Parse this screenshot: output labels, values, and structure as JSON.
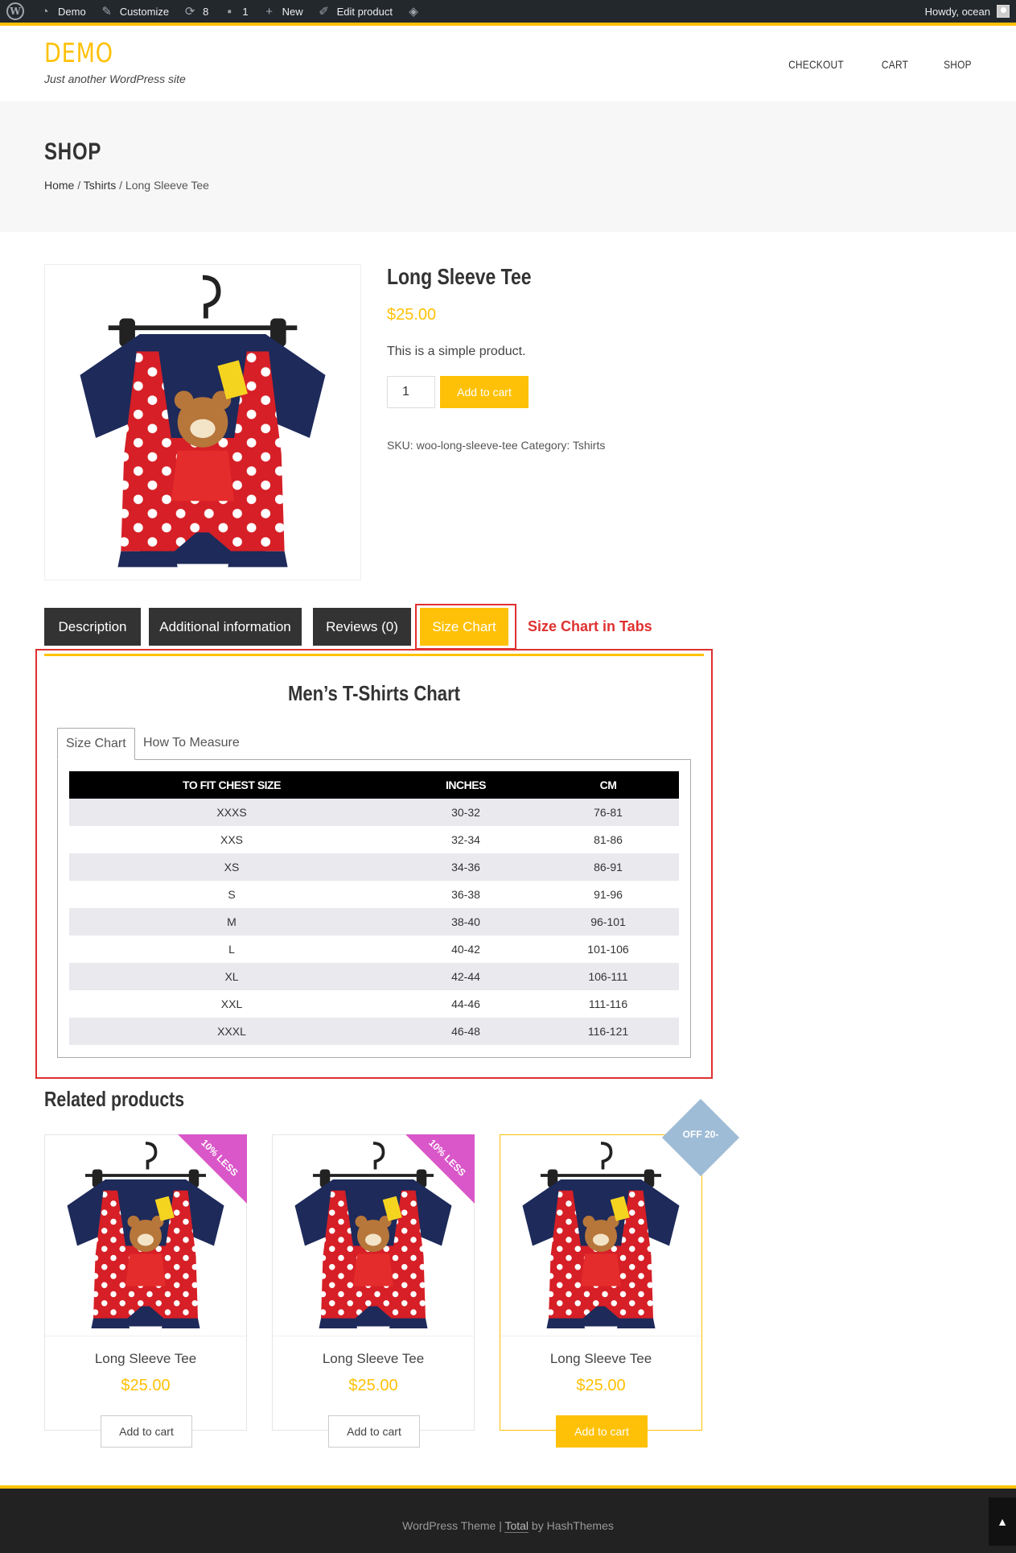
{
  "admin_bar": {
    "logo": "W",
    "items": [
      {
        "label": "Demo",
        "icon": "dashboard-icon"
      },
      {
        "label": "Customize",
        "icon": "brush-icon"
      },
      {
        "label": "8",
        "icon": "updates-icon"
      },
      {
        "label": "1",
        "icon": "comment-icon"
      },
      {
        "label": "New",
        "icon": "plus-icon"
      },
      {
        "label": "Edit product",
        "icon": "pencil-icon"
      }
    ],
    "greeting": "Howdy, ocean"
  },
  "header": {
    "logo": "DEMO",
    "tagline": "Just another WordPress site",
    "nav": [
      "CHECKOUT",
      "CART",
      "SHOP"
    ]
  },
  "page": {
    "title": "SHOP",
    "breadcrumb": {
      "home": "Home",
      "category": "Tshirts",
      "current": "Long Sleeve Tee",
      "sep": " / "
    }
  },
  "product": {
    "title": "Long Sleeve Tee",
    "price": "$25.00",
    "description": "This is a simple product.",
    "quantity": "1",
    "add_to_cart": "Add to cart",
    "sku_label": "SKU:",
    "sku": "woo-long-sleeve-tee",
    "category_label": "Category:",
    "category": "Tshirts"
  },
  "tabs": {
    "items": [
      "Description",
      "Additional information",
      "Reviews (0)",
      "Size Chart"
    ],
    "active": "Size Chart",
    "annotation": "Size Chart in Tabs"
  },
  "size_chart": {
    "title": "Men’s T-Shirts Chart",
    "inner_tabs": [
      "Size Chart",
      "How To Measure"
    ],
    "headers": [
      "TO FIT CHEST SIZE",
      "INCHES",
      "CM"
    ],
    "rows": [
      [
        "XXXS",
        "30-32",
        "76-81"
      ],
      [
        "XXS",
        "32-34",
        "81-86"
      ],
      [
        "XS",
        "34-36",
        "86-91"
      ],
      [
        "S",
        "36-38",
        "91-96"
      ],
      [
        "M",
        "38-40",
        "96-101"
      ],
      [
        "L",
        "40-42",
        "101-106"
      ],
      [
        "XL",
        "42-44",
        "106-111"
      ],
      [
        "XXL",
        "44-46",
        "111-116"
      ],
      [
        "XXXL",
        "46-48",
        "116-121"
      ]
    ]
  },
  "related": {
    "title": "Related products",
    "products": [
      {
        "name": "Long Sleeve Tee",
        "price": "$25.00",
        "button": "Add to cart",
        "badge": "10% LESS"
      },
      {
        "name": "Long Sleeve Tee",
        "price": "$25.00",
        "button": "Add to cart",
        "badge": "10% LESS"
      },
      {
        "name": "Long Sleeve Tee",
        "price": "$25.00",
        "button": "Add to cart",
        "badge": "OFF 20-"
      }
    ]
  },
  "footer": {
    "prefix": "WordPress Theme | ",
    "link": "Total",
    "suffix": " by HashThemes"
  },
  "colors": {
    "accent": "#ffc107",
    "dark": "#333333",
    "annotation": "#e03030",
    "ribbon": "#d957c9",
    "diamond": "#9fbcd6"
  }
}
